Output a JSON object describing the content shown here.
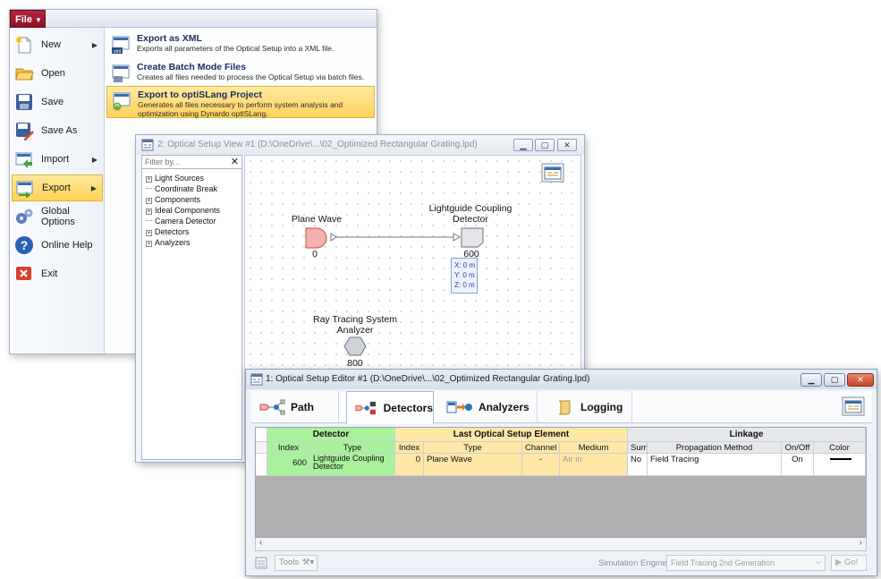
{
  "file_menu": {
    "button_label": "File",
    "items": [
      {
        "label": "New",
        "icon": "new-file-icon",
        "submenu": true
      },
      {
        "label": "Open",
        "icon": "folder-open-icon",
        "submenu": false
      },
      {
        "label": "Save",
        "icon": "save-icon",
        "submenu": false
      },
      {
        "label": "Save As",
        "icon": "save-as-icon",
        "submenu": false
      },
      {
        "label": "Import",
        "icon": "import-icon",
        "submenu": true
      },
      {
        "label": "Export",
        "icon": "export-icon",
        "submenu": true,
        "selected": true
      },
      {
        "label": "Global Options",
        "icon": "gears-icon",
        "submenu": false
      },
      {
        "label": "Online Help",
        "icon": "help-icon",
        "submenu": false
      },
      {
        "label": "Exit",
        "icon": "exit-icon",
        "submenu": false
      }
    ],
    "export_submenu": [
      {
        "title": "Export as XML",
        "desc": "Exports all parameters of the Optical Setup into a XML file."
      },
      {
        "title": "Create Batch Mode Files",
        "desc": "Creates all files needed to process the Optical Setup via batch files."
      },
      {
        "title": "Export to optiSLang Project",
        "desc_1": "Generates all files necessary to perform system analysis and",
        "desc_2": "optimization using Dynardo optiSLang.",
        "selected": true
      }
    ]
  },
  "setup_view": {
    "title": "2: Optical Setup View #1 (D:\\OneDrive\\...\\02_Optimized Rectangular Grating.lpd)",
    "filter_placeholder": "Filter by...",
    "filter_clear": "✕",
    "tree": [
      {
        "label": "Light Sources",
        "expandable": true
      },
      {
        "label": "Coordinate Break",
        "expandable": false
      },
      {
        "label": "Components",
        "expandable": true
      },
      {
        "label": "Ideal Components",
        "expandable": true
      },
      {
        "label": "Camera Detector",
        "expandable": false
      },
      {
        "label": "Detectors",
        "expandable": true
      },
      {
        "label": "Analyzers",
        "expandable": true
      }
    ],
    "nodes": {
      "plane_wave": {
        "label": "Plane Wave",
        "index": "0"
      },
      "detector": {
        "label_1": "Lightguide Coupling",
        "label_2": "Detector",
        "index": "600"
      },
      "analyzer": {
        "label_1": "Ray Tracing System",
        "label_2": "Analyzer",
        "index": "800"
      }
    },
    "coords": {
      "x": "X: 0 m",
      "y": "Y: 0 m",
      "z": "Z: 0 m"
    }
  },
  "editor": {
    "title": "1: Optical Setup Editor #1 (D:\\OneDrive\\...\\02_Optimized Rectangular Grating.lpd)",
    "tabs": [
      {
        "label": "Path",
        "icon": "path-icon"
      },
      {
        "label": "Detectors",
        "icon": "detectors-icon",
        "selected": true
      },
      {
        "label": "Analyzers",
        "icon": "analyzers-icon"
      },
      {
        "label": "Logging",
        "icon": "logging-icon"
      }
    ],
    "groups": {
      "detector": "Detector",
      "last_element": "Last Optical Setup Element",
      "linkage": "Linkage"
    },
    "columns": [
      "Index",
      "Type",
      "Index",
      "Type",
      "Channel",
      "Medium",
      "Sum",
      "Propagation Method",
      "On/Off",
      "Color"
    ],
    "rows": [
      {
        "det_index": "600",
        "det_type_1": "Lightguide Coupling",
        "det_type_2": "Detector",
        "el_index": "0",
        "el_type": "Plane Wave",
        "channel": "-",
        "medium": "Air in",
        "sum": "No",
        "method": "Field Tracing",
        "onoff": "On",
        "color": "black-line"
      }
    ],
    "status": {
      "tools_label": "Tools",
      "engine_label": "Simulation Engine",
      "engine_value": "Field Tracing 2nd Generation",
      "go_label": "Go!"
    }
  },
  "colors": {
    "file_button": "#a01c34",
    "menu_highlight": "#ffd257",
    "detector_group": "#a9f19a",
    "element_group": "#ffe8a6"
  }
}
